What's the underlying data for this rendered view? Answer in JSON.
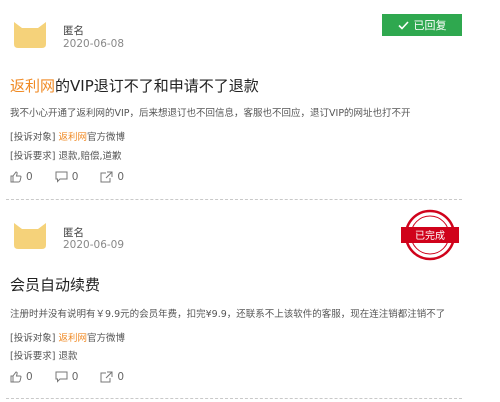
{
  "complaints": [
    {
      "user": "匿名",
      "date": "2020-06-08",
      "status": "已回复",
      "title_brand": "返利网",
      "title_rest": "的VIP退订不了和申请不了退款",
      "description": "我不小心开通了返利网的VIP，后来想退订也不回信息，客服也不回应，退订VIP的网址也打不开",
      "target_label": "[投诉对象]",
      "target_brand": "返利网",
      "target_rest": "官方微博",
      "demand_label": "[投诉要求]",
      "demand_value": "退款,赔偿,道歉",
      "likes": "0",
      "comments": "0",
      "shares": "0"
    },
    {
      "user": "匿名",
      "date": "2020-06-09",
      "status": "已完成",
      "title_brand": "",
      "title_rest": "会员自动续费",
      "description": "注册时并没有说明有￥9.9元的会员年费，扣完¥9.9，还联系不上该软件的客服，现在连注销都注销不了",
      "target_label": "[投诉对象]",
      "target_brand": "返利网",
      "target_rest": "官方微博",
      "demand_label": "[投诉要求]",
      "demand_value": "退款",
      "likes": "0",
      "comments": "0",
      "shares": "0"
    }
  ],
  "colors": {
    "accent": "#f08a24",
    "replied": "#2fa84f",
    "stamp": "#d0021b",
    "avatar": "#f5d27a"
  },
  "icons": [
    "cat-avatar-icon",
    "check-icon",
    "thumbs-up-icon",
    "comment-icon",
    "share-icon",
    "stamp-icon"
  ]
}
